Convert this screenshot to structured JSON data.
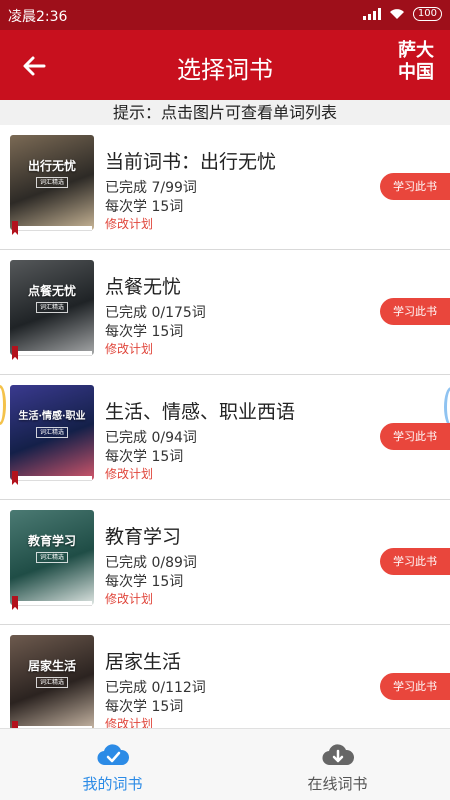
{
  "status_bar": {
    "time": "凌晨2:36",
    "battery": "100"
  },
  "app_bar": {
    "title": "选择词书",
    "logo_line1": "萨大",
    "logo_line2": "中国"
  },
  "hint": "提示：点击图片可查看单词列表",
  "books": [
    {
      "name": "当前词书：出行无忧",
      "cover_title": "出行无忧",
      "cover_badge": "词汇精选",
      "progress": "已完成 7/99词",
      "per_session": "每次学 15词",
      "edit": "修改计划",
      "button": "学习此书",
      "cover_colors": [
        "#2d2a26",
        "#7b6a55",
        "#c9b697"
      ]
    },
    {
      "name": "点餐无忧",
      "cover_title": "点餐无忧",
      "cover_badge": "词汇精选",
      "progress": "已完成 0/175词",
      "per_session": "每次学 15词",
      "edit": "修改计划",
      "button": "学习此书",
      "cover_colors": [
        "#1f2326",
        "#55585a",
        "#a7a9aa"
      ]
    },
    {
      "name": "生活、情感、职业西语",
      "cover_title": "生活·情感·职业",
      "cover_badge": "词汇精选",
      "progress": "已完成 0/94词",
      "per_session": "每次学 15词",
      "edit": "修改计划",
      "button": "学习此书",
      "cover_colors": [
        "#142049",
        "#3a3a8f",
        "#d2566a"
      ]
    },
    {
      "name": "教育学习",
      "cover_title": "教育学习",
      "cover_badge": "词汇精选",
      "progress": "已完成 0/89词",
      "per_session": "每次学 15词",
      "edit": "修改计划",
      "button": "学习此书",
      "cover_colors": [
        "#1f4d46",
        "#4b7a73",
        "#dfe6e3"
      ]
    },
    {
      "name": "居家生活",
      "cover_title": "居家生活",
      "cover_badge": "词汇精选",
      "progress": "已完成 0/112词",
      "per_session": "每次学 15词",
      "edit": "修改计划",
      "button": "学习此书",
      "cover_colors": [
        "#2b2320",
        "#6d5a4e",
        "#c9b8a6"
      ]
    }
  ],
  "tabs": [
    {
      "label": "我的词书",
      "icon": "cloud-check-icon",
      "color": "#2c8be6",
      "active": true
    },
    {
      "label": "在线词书",
      "icon": "cloud-download-icon",
      "color": "#666666",
      "active": false
    }
  ],
  "colors": {
    "status_bar": "#9e0f1a",
    "app_bar": "#c8101e",
    "accent_button": "#e9463c",
    "edit_link": "#e0463b"
  }
}
